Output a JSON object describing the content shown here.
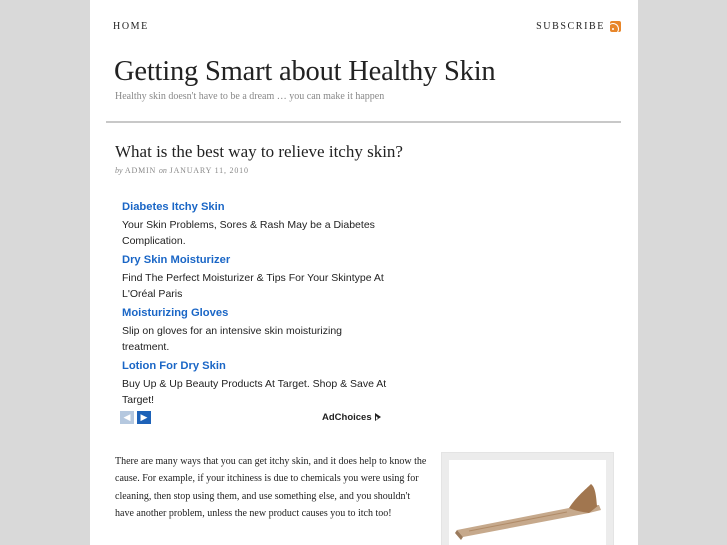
{
  "nav": {
    "home": "Home",
    "subscribe": "Subscribe",
    "rss_icon": "rss-icon"
  },
  "site": {
    "title": "Getting Smart about Healthy Skin",
    "tagline": "Healthy skin doesn't have to be a dream … you can make it happen"
  },
  "post": {
    "title": "What is the best way to relieve itchy skin?",
    "by": "by",
    "author": "admin",
    "on": "on",
    "date": "January 11, 2010",
    "body": "There are many ways that you can get itchy skin, and it does help to know the cause. For example, if your itchiness is due to chemicals you were using for cleaning, then stop using them, and use something else, and you shouldn't have another problem, unless the new product causes you to itch too!"
  },
  "ads": {
    "items": [
      {
        "headline": "Diabetes Itchy Skin",
        "description": "Your Skin Problems, Sores & Rash May be a Diabetes Complication."
      },
      {
        "headline": "Dry Skin Moisturizer",
        "description": "Find The Perfect Moisturizer & Tips For Your Skintype At L'Oréal Paris"
      },
      {
        "headline": "Moisturizing Gloves",
        "description": "Slip on gloves for an intensive skin moisturizing treatment."
      },
      {
        "headline": "Lotion For Dry Skin",
        "description": "Buy Up & Up Beauty Products At Target. Shop & Save At Target!"
      }
    ],
    "prev_icon": "chevron-left-icon",
    "next_icon": "chevron-right-icon",
    "adchoices": "AdChoices"
  },
  "colors": {
    "background": "#d9d9d9",
    "page": "#ffffff",
    "ad_link": "#1a66c6",
    "rss": "#e8862a"
  }
}
